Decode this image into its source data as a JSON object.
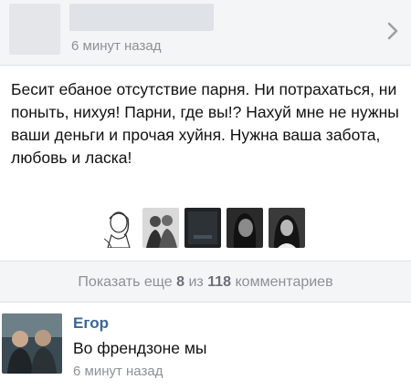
{
  "post": {
    "time": "6 минут назад",
    "text": "Бесит ебаное отсутствие парня. Ни потрахаться, ни поныть, нихуя! Парни, где вы!? Нахуй мне не нужны ваши деньги и прочая хуйня. Нужна ваша забота, любовь и ласка!",
    "chevron_icon": "chevron-right-icon",
    "gifts": [
      "gift-sketch-girl",
      "gift-couple",
      "gift-dark-photo",
      "gift-girl-portrait",
      "gift-girl-dark"
    ]
  },
  "show_more": {
    "prefix": "Показать еще",
    "shown": "8",
    "of": "из",
    "total": "118",
    "suffix": "комментариев"
  },
  "comment": {
    "author": "Егор",
    "text": "Во френдзоне мы",
    "time": "6 минут назад"
  },
  "colors": {
    "link": "#3b6698",
    "muted": "#8c9198",
    "panel_bg": "#f4f5f7"
  }
}
